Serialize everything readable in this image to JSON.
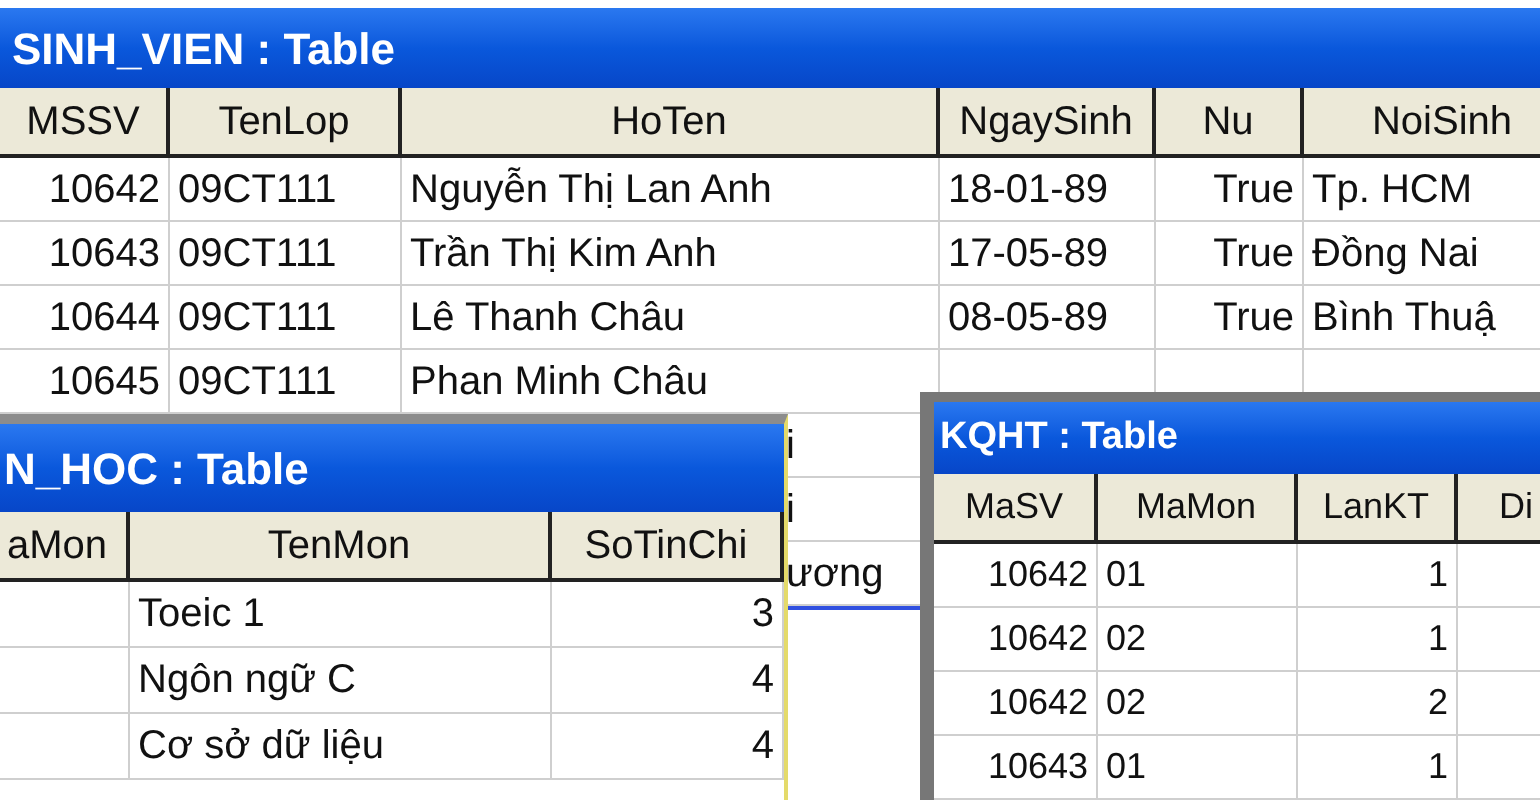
{
  "windows": [
    {
      "title": "SINH_VIEN : Table",
      "columns": [
        "MSSV",
        "TenLop",
        "HoTen",
        "NgaySinh",
        "Nu",
        "NoiSinh"
      ],
      "rows": [
        [
          "10642",
          "09CT111",
          "Nguyễn Thị Lan Anh",
          "18-01-89",
          "True",
          "Tp. HCM"
        ],
        [
          "10643",
          "09CT111",
          "Trần Thị Kim Anh",
          "17-05-89",
          "True",
          "Đồng Nai"
        ],
        [
          "10644",
          "09CT111",
          "Lê Thanh Châu",
          "08-05-89",
          "True",
          "Bình Thuậ"
        ],
        [
          "10645",
          "09CT111",
          "Phan Minh Châu"
        ]
      ],
      "partly_hidden_rows": [
        "i",
        "i",
        "ương"
      ]
    },
    {
      "title": "N_HOC : Table",
      "columns": [
        "aMon",
        "TenMon",
        "SoTinChi"
      ],
      "rows": [
        [
          "",
          "Toeic 1",
          "3"
        ],
        [
          "",
          "Ngôn ngữ C",
          "4"
        ],
        [
          "",
          "Cơ sở dữ liệu",
          "4"
        ]
      ]
    },
    {
      "title": "KQHT : Table",
      "columns": [
        "MaSV",
        "MaMon",
        "LanKT",
        "Di"
      ],
      "rows": [
        [
          "10642",
          "01",
          "1"
        ],
        [
          "10642",
          "02",
          "1"
        ],
        [
          "10642",
          "02",
          "2"
        ],
        [
          "10643",
          "01",
          "1"
        ]
      ]
    }
  ]
}
